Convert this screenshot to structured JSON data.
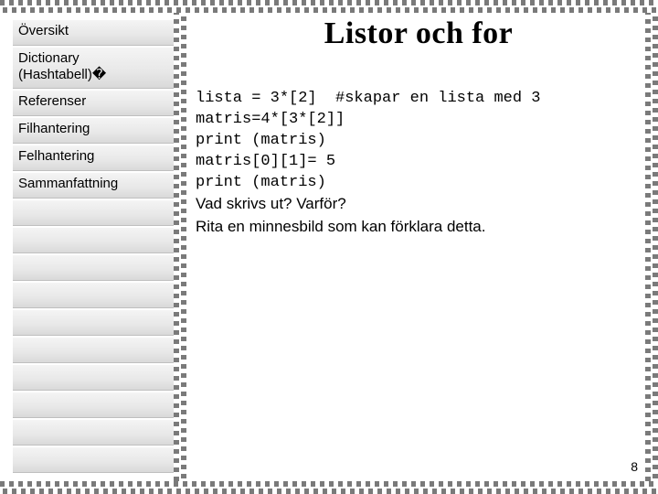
{
  "sidebar": {
    "items": [
      {
        "label": "Översikt"
      },
      {
        "label": "Dictionary (Hashtabell)�"
      },
      {
        "label": "Referenser"
      },
      {
        "label": "Filhantering"
      },
      {
        "label": "Felhantering"
      },
      {
        "label": "Sammanfattning"
      }
    ],
    "empty_slots": 10
  },
  "title": "Listor och for",
  "code_lines": [
    "lista = 3*[2]  #skapar en lista med 3",
    "matris=4*[3*[2]]",
    "print (matris)",
    "matris[0][1]= 5",
    "print (matris)"
  ],
  "question_lines": [
    "Vad skrivs ut? Varför?",
    "Rita en minnesbild som kan förklara detta."
  ],
  "page_number": "8"
}
